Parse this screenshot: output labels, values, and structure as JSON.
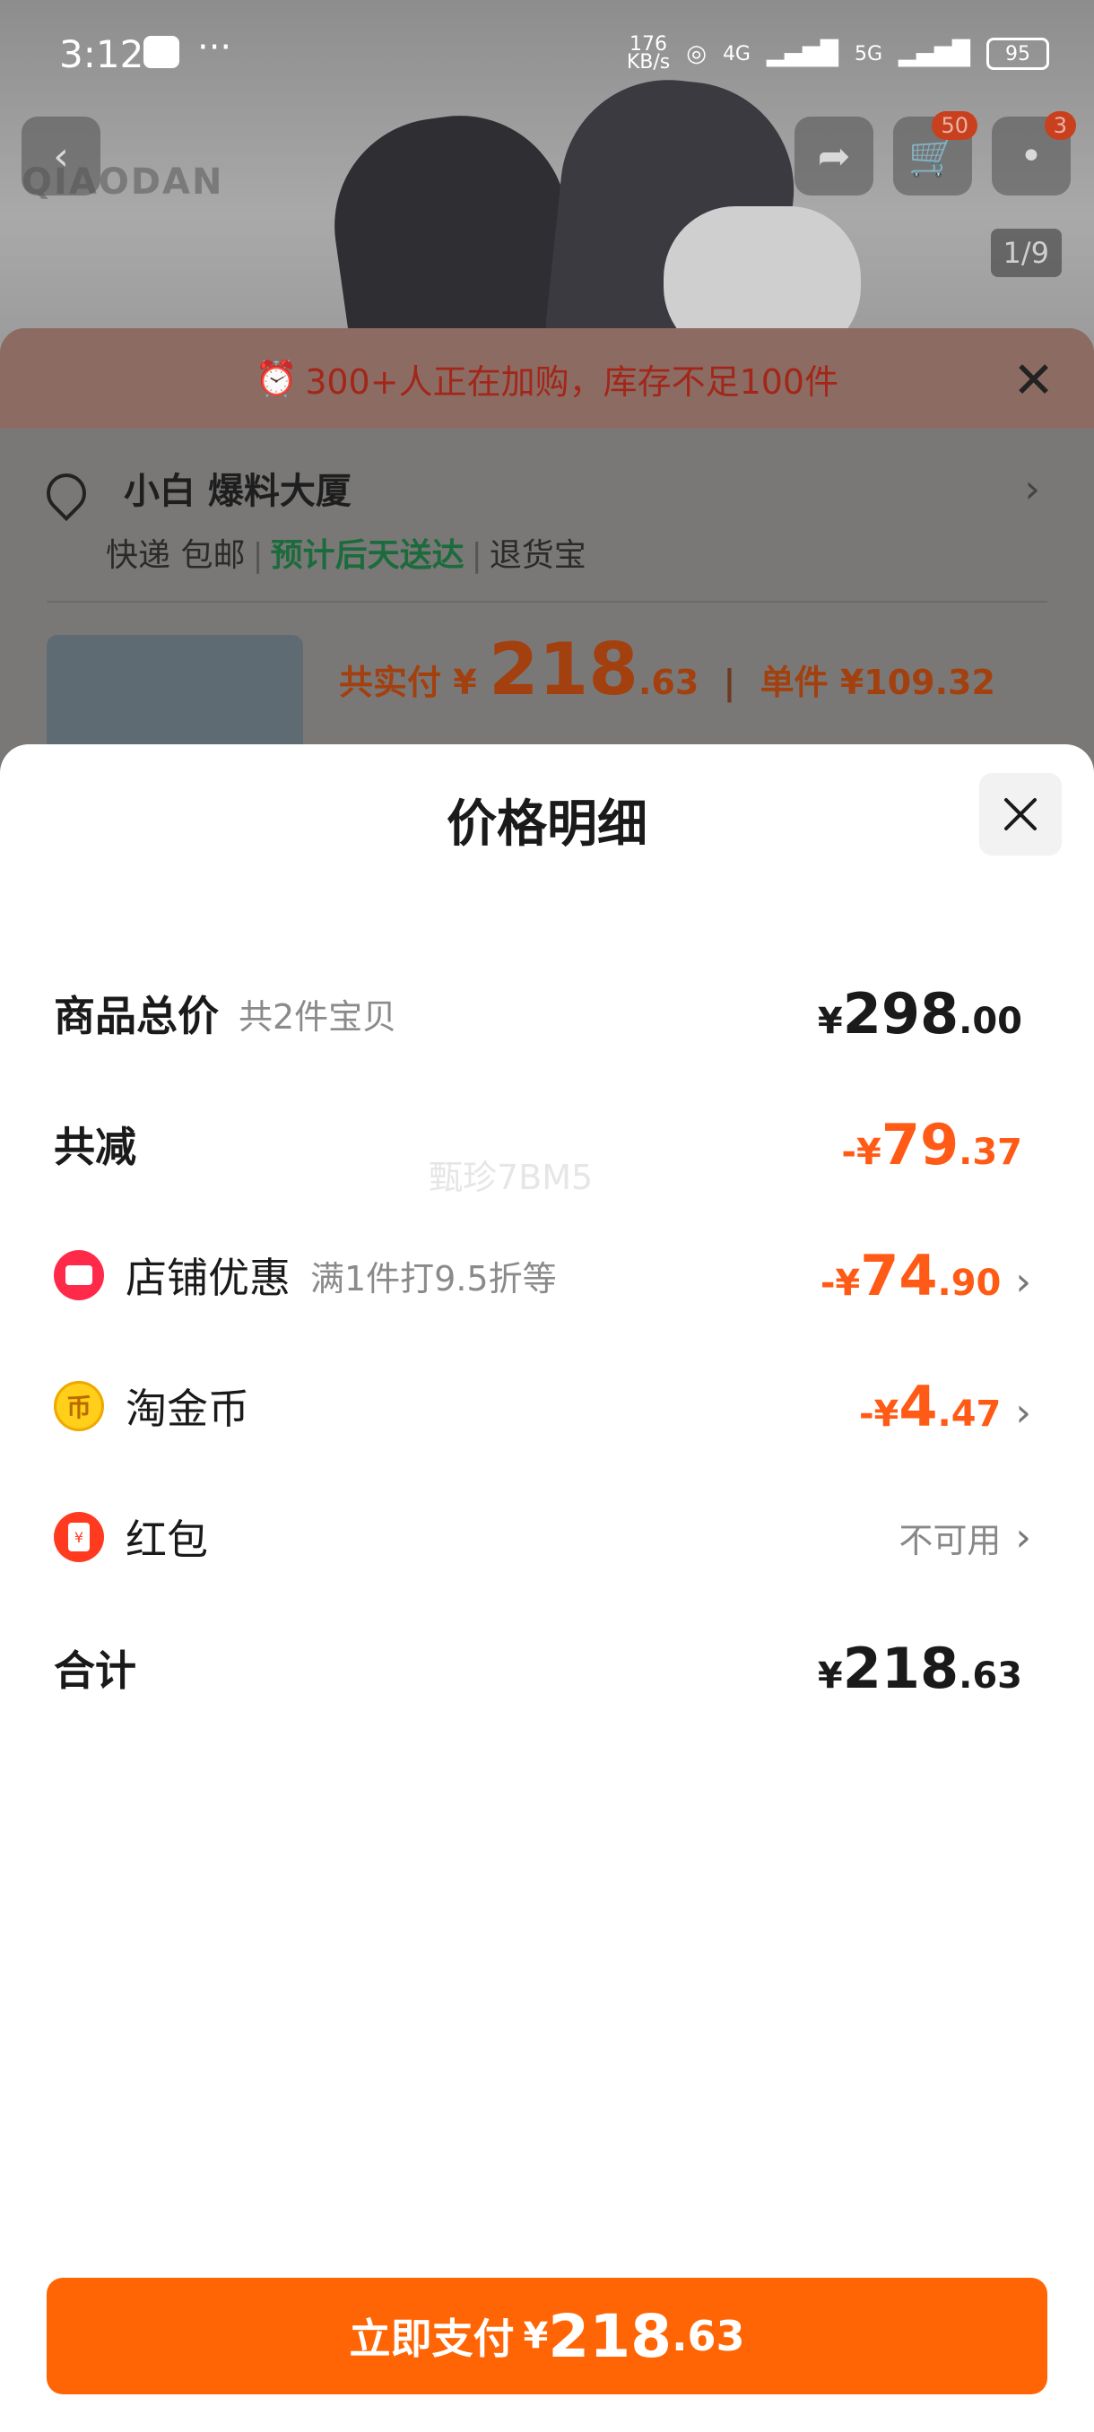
{
  "status_bar": {
    "time": "3:12",
    "net_speed_top": "176",
    "net_speed_bottom": "KB/s",
    "net_4g": "4G",
    "net_5g": "5G",
    "battery": "95"
  },
  "product_page": {
    "brand": "QIAODAN",
    "cart_count": "50",
    "msg_count": "3",
    "image_counter": "1/9",
    "alert": "300+人正在加购，库存不足100件",
    "address": "小白 爆料大厦",
    "ship_express": "快递 包邮",
    "ship_eta": "预计后天送达",
    "ship_return": "退货宝",
    "total_label": "共实付",
    "total_cur": "¥",
    "total_int": "218",
    "total_dec": ".63",
    "unit_label": "单件 ¥109.32"
  },
  "price_sheet": {
    "title": "价格明细",
    "watermark": "甄珍7BM5",
    "rows": [
      {
        "label": "商品总价",
        "sub": "共2件宝贝",
        "cur": "¥",
        "int": "298",
        "dec": ".00"
      },
      {
        "label": "共减",
        "cur": "-¥",
        "int": "79",
        "dec": ".37"
      },
      {
        "label": "店铺优惠",
        "sub": "满1件打9.5折等",
        "cur": "-¥",
        "int": "74",
        "dec": ".90"
      },
      {
        "label": "淘金币",
        "cur": "-¥",
        "int": "4",
        "dec": ".47"
      },
      {
        "label": "红包",
        "status": "不可用"
      },
      {
        "label": "合计",
        "cur": "¥",
        "int": "218",
        "dec": ".63"
      }
    ],
    "pay_button": {
      "label": "立即支付",
      "cur": "¥",
      "int": "218",
      "dec": ".63"
    }
  },
  "colors": {
    "accent": "#ff6505",
    "discount": "#ff5a16",
    "text": "#1a1a1a"
  }
}
